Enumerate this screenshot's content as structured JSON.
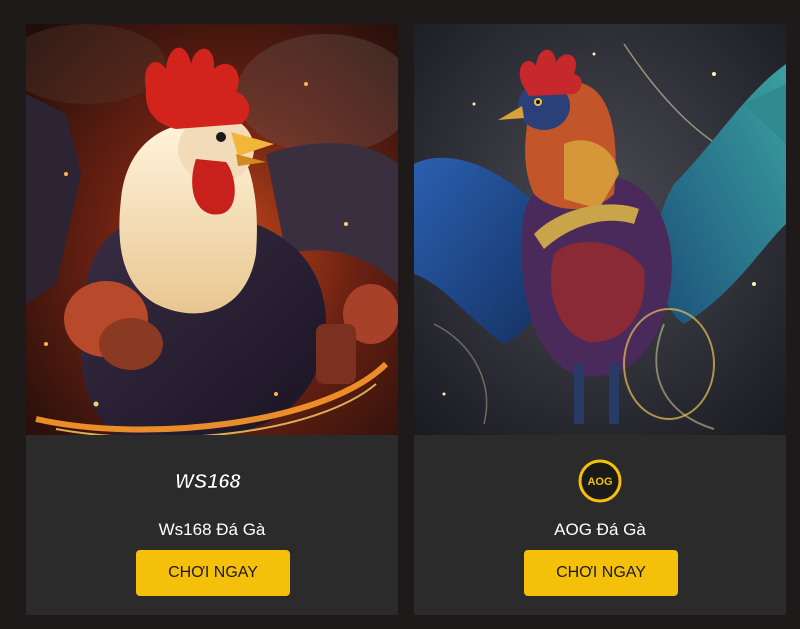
{
  "cards": [
    {
      "title": "Ws168 Đá Gà",
      "button_label": "CHƠI NGAY",
      "logo_text": "WS168",
      "logo_icon": "ws168-logo",
      "art_icon": "fire-rooster-fighter-image",
      "accent": "#e0302a"
    },
    {
      "title": "AOG Đá Gà",
      "button_label": "CHƠI NGAY",
      "logo_text": "AOG",
      "logo_icon": "aog-logo",
      "art_icon": "blue-rooster-flying-image",
      "accent": "#f5c00a"
    }
  ],
  "colors": {
    "page_background": "#1d1a19",
    "card_background": "#2b2b2b",
    "button": "#f5c00a",
    "button_text": "#1a1a1a",
    "title_text": "#ffffff"
  }
}
